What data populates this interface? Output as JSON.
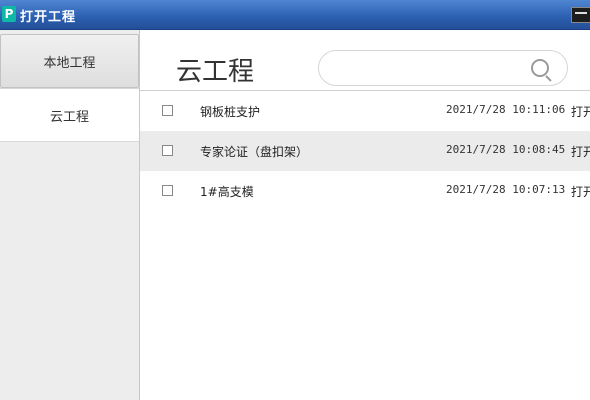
{
  "window": {
    "title": "打开工程",
    "app_icon_glyph": "P"
  },
  "sidebar": {
    "items": [
      {
        "label": "本地工程"
      },
      {
        "label": "云工程"
      }
    ]
  },
  "main": {
    "heading": "云工程",
    "search": {
      "placeholder": "",
      "value": ""
    },
    "projects": [
      {
        "name": "钢板桩支护",
        "time": "2021/7/28 10:11:06",
        "action": "打开"
      },
      {
        "name": "专家论证（盘扣架）",
        "time": "2021/7/28 10:08:45",
        "action": "打开"
      },
      {
        "name": "1#高支模",
        "time": "2021/7/28 10:07:13",
        "action": "打开"
      }
    ]
  },
  "colors": {
    "titlebar": "#2b5fb0",
    "row_highlight": "#ebebeb",
    "sidebar_bg": "#ededed"
  }
}
